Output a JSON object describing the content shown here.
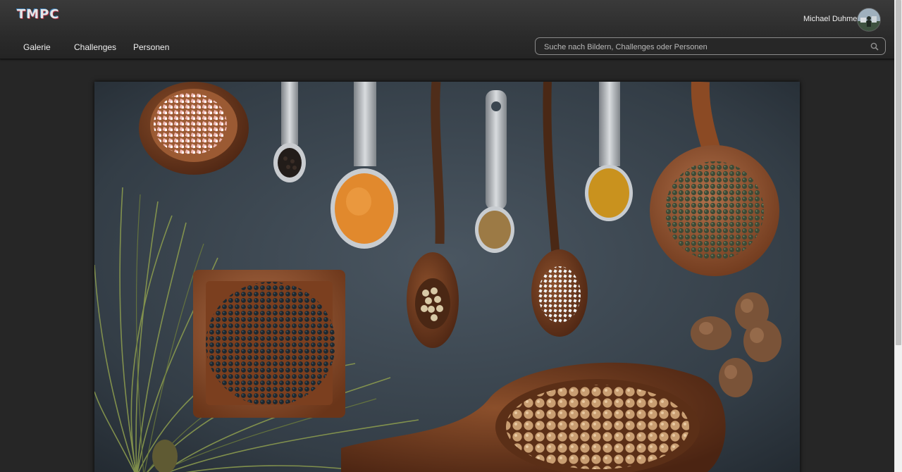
{
  "header": {
    "logo": "TMPC",
    "nav": [
      {
        "label": "Galerie"
      },
      {
        "label": "Challenges"
      },
      {
        "label": "Personen"
      }
    ],
    "user": {
      "name": "Michael Duhme"
    },
    "search": {
      "placeholder": "Suche nach Bildern, Challenges oder Personen",
      "value": ""
    }
  },
  "main": {
    "photo": {
      "subject": "spices in spoons and bowls on dark slate"
    }
  },
  "colors": {
    "header_bg": "#2e2e2e",
    "page_bg": "#262626",
    "slate": "#3b4650"
  }
}
